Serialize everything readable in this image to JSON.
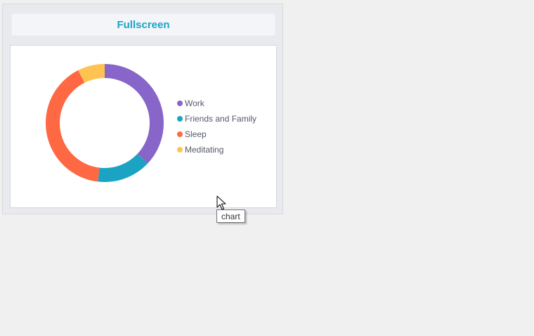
{
  "panel": {
    "title": "Fullscreen"
  },
  "tooltip": {
    "text": "chart"
  },
  "chart_data": {
    "type": "pie",
    "variant": "donut",
    "categories": [
      "Work",
      "Friends and Family",
      "Sleep",
      "Meditating"
    ],
    "values": [
      10,
      4,
      11,
      2
    ],
    "colors": [
      "#8765c9",
      "#1ba3c4",
      "#fe6943",
      "#ffc352"
    ],
    "legend_position": "right",
    "title": "",
    "start_angle_deg": 0,
    "direction": "clockwise"
  },
  "colors": {
    "accent": "#1ba3c4",
    "legend_text": "#555a66"
  }
}
